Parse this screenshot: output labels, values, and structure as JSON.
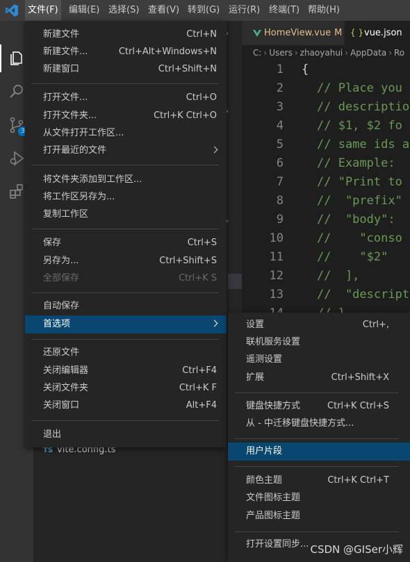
{
  "menubar": {
    "items": [
      {
        "label": "文件(F)"
      },
      {
        "label": "编辑(E)"
      },
      {
        "label": "选择(S)"
      },
      {
        "label": "查看(V)"
      },
      {
        "label": "转到(G)"
      },
      {
        "label": "运行(R)"
      },
      {
        "label": "终端(T)"
      },
      {
        "label": "帮助(H)"
      }
    ]
  },
  "activity_bar": {
    "source_control_badge": "3"
  },
  "tabs": [
    {
      "label": "HomeView.vue",
      "modified": "M"
    },
    {
      "label": "vue.json"
    }
  ],
  "breadcrumb": [
    "C:",
    "Users",
    "zhaoyahui",
    "AppData",
    "Ro"
  ],
  "editor": {
    "lines": [
      {
        "no": "1",
        "text": "{"
      },
      {
        "no": "2",
        "text": "// Place you"
      },
      {
        "no": "3",
        "text": "// descriptio"
      },
      {
        "no": "4",
        "text": "// $1, $2 fo"
      },
      {
        "no": "5",
        "text": "// same ids a"
      },
      {
        "no": "6",
        "text": "// Example:"
      },
      {
        "no": "7",
        "text": "// \"Print to"
      },
      {
        "no": "8",
        "text": "//  \"prefix\""
      },
      {
        "no": "9",
        "text": "//  \"body\":"
      },
      {
        "no": "10",
        "text": "//    \"conso"
      },
      {
        "no": "11",
        "text": "//    \"$2\""
      },
      {
        "no": "12",
        "text": "//  ],"
      },
      {
        "no": "13",
        "text": "//  \"descript"
      },
      {
        "no": "14",
        "text": "// }"
      }
    ]
  },
  "explorer": {
    "file": "vite.config.ts",
    "file_icon": "TS"
  },
  "file_menu": {
    "items": [
      {
        "label": "新建文件",
        "shortcut": "Ctrl+N"
      },
      {
        "label": "新建文件...",
        "shortcut": "Ctrl+Alt+Windows+N"
      },
      {
        "label": "新建窗口",
        "shortcut": "Ctrl+Shift+N"
      },
      {
        "label": "打开文件...",
        "shortcut": "Ctrl+O"
      },
      {
        "label": "打开文件夹...",
        "shortcut": "Ctrl+K Ctrl+O"
      },
      {
        "label": "从文件打开工作区..."
      },
      {
        "label": "打开最近的文件"
      },
      {
        "label": "将文件夹添加到工作区..."
      },
      {
        "label": "将工作区另存为..."
      },
      {
        "label": "复制工作区"
      },
      {
        "label": "保存",
        "shortcut": "Ctrl+S"
      },
      {
        "label": "另存为...",
        "shortcut": "Ctrl+Shift+S"
      },
      {
        "label": "全部保存",
        "shortcut": "Ctrl+K S"
      },
      {
        "label": "自动保存"
      },
      {
        "label": "首选项"
      },
      {
        "label": "还原文件"
      },
      {
        "label": "关闭编辑器",
        "shortcut": "Ctrl+F4"
      },
      {
        "label": "关闭文件夹",
        "shortcut": "Ctrl+K F"
      },
      {
        "label": "关闭窗口",
        "shortcut": "Alt+F4"
      },
      {
        "label": "退出"
      }
    ]
  },
  "preferences_submenu": {
    "items": [
      {
        "label": "设置",
        "shortcut": "Ctrl+,"
      },
      {
        "label": "联机服务设置"
      },
      {
        "label": "遥测设置"
      },
      {
        "label": "扩展",
        "shortcut": "Ctrl+Shift+X"
      },
      {
        "label": "键盘快捷方式",
        "shortcut": "Ctrl+K Ctrl+S"
      },
      {
        "label": "从 - 中迁移键盘快捷方式..."
      },
      {
        "label": "用户片段"
      },
      {
        "label": "颜色主题",
        "shortcut": "Ctrl+K Ctrl+T"
      },
      {
        "label": "文件图标主题"
      },
      {
        "label": "产品图标主题"
      },
      {
        "label": "打开设置同步..."
      }
    ]
  },
  "watermark": "CSDN @GISer小辉",
  "colors": {
    "menubar": "#3c3c3c",
    "menu_bg": "#252526",
    "highlight": "#094771",
    "comment": "#6a9955"
  }
}
